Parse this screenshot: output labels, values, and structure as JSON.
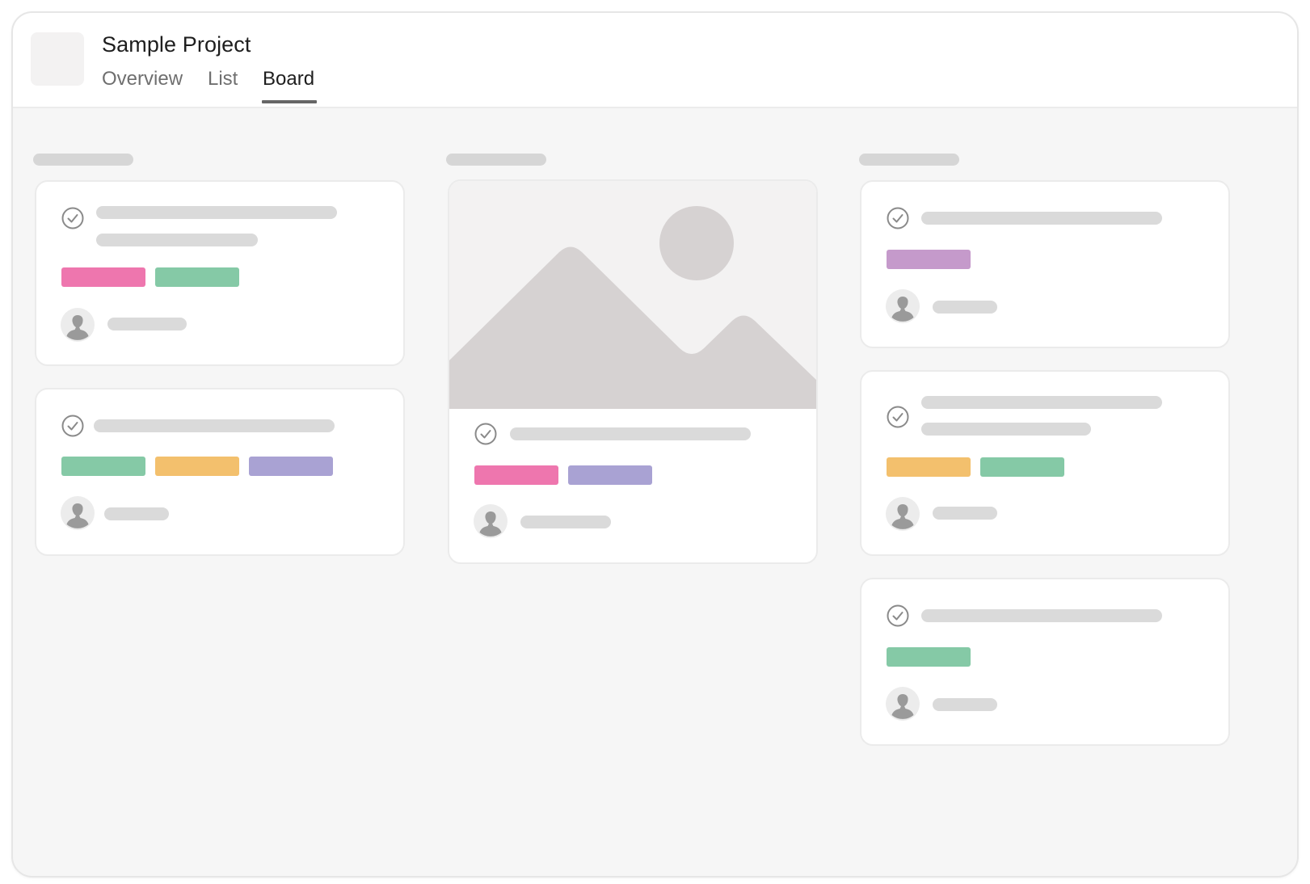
{
  "project": {
    "title": "Sample Project",
    "icon": "project-placeholder-icon"
  },
  "tabs": [
    {
      "label": "Overview",
      "active": false
    },
    {
      "label": "List",
      "active": false
    },
    {
      "label": "Board",
      "active": true
    }
  ],
  "colors": {
    "pink": "#ee76ae",
    "green": "#85c9a6",
    "yellow": "#f3c06d",
    "purple": "#a9a2d3",
    "lilac": "#c59acb",
    "skeleton": "#dadada",
    "placeholder_image": "#d6d2d2"
  },
  "board": {
    "columns": [
      {
        "cards": [
          {
            "tags": [
              "pink",
              "green"
            ],
            "has_image": false
          },
          {
            "tags": [
              "green",
              "yellow",
              "purple"
            ],
            "has_image": false
          }
        ]
      },
      {
        "cards": [
          {
            "tags": [
              "pink",
              "purple"
            ],
            "has_image": true
          }
        ]
      },
      {
        "cards": [
          {
            "tags": [
              "lilac"
            ],
            "has_image": false
          },
          {
            "tags": [
              "yellow",
              "green"
            ],
            "has_image": false
          },
          {
            "tags": [
              "green"
            ],
            "has_image": false
          }
        ]
      }
    ]
  }
}
